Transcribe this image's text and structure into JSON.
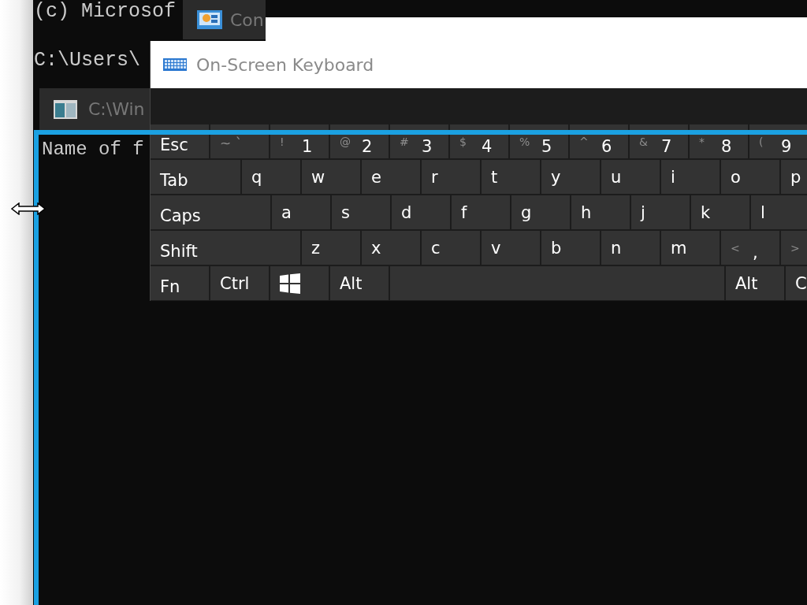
{
  "console_back": {
    "lines": [
      "(c) Microsof",
      "C:\\Users\\"
    ]
  },
  "console_tab": {
    "title": "Con"
  },
  "console_window": {
    "title": "C:\\Win",
    "lines": [
      "Name of f"
    ]
  },
  "keyboard_window": {
    "title": "On-Screen Keyboard",
    "rows": [
      [
        {
          "kind": "key",
          "label": "Esc"
        },
        {
          "kind": "dual",
          "shift": "~",
          "label": "`"
        },
        {
          "kind": "key",
          "shift": "!",
          "label": "1"
        },
        {
          "kind": "key",
          "shift": "@",
          "label": "2"
        },
        {
          "kind": "key",
          "shift": "#",
          "label": "3"
        },
        {
          "kind": "key",
          "shift": "$",
          "label": "4"
        },
        {
          "kind": "key",
          "shift": "%",
          "label": "5"
        },
        {
          "kind": "key",
          "shift": "^",
          "label": "6"
        },
        {
          "kind": "key",
          "shift": "&",
          "label": "7"
        },
        {
          "kind": "key",
          "shift": "*",
          "label": "8"
        },
        {
          "kind": "key",
          "shift": "(",
          "label": "9"
        }
      ],
      [
        {
          "kind": "tab",
          "label": "Tab"
        },
        {
          "kind": "key",
          "label": "q"
        },
        {
          "kind": "key",
          "label": "w"
        },
        {
          "kind": "key",
          "label": "e"
        },
        {
          "kind": "key",
          "label": "r"
        },
        {
          "kind": "key",
          "label": "t"
        },
        {
          "kind": "key",
          "label": "y"
        },
        {
          "kind": "key",
          "label": "u"
        },
        {
          "kind": "key",
          "label": "i"
        },
        {
          "kind": "key",
          "label": "o"
        },
        {
          "kind": "key",
          "label": "p"
        }
      ],
      [
        {
          "kind": "caps",
          "label": "Caps"
        },
        {
          "kind": "key",
          "label": "a"
        },
        {
          "kind": "key",
          "label": "s"
        },
        {
          "kind": "key",
          "label": "d"
        },
        {
          "kind": "key",
          "label": "f"
        },
        {
          "kind": "key",
          "label": "g"
        },
        {
          "kind": "key",
          "label": "h"
        },
        {
          "kind": "key",
          "label": "j"
        },
        {
          "kind": "key",
          "label": "k"
        },
        {
          "kind": "key",
          "label": "l"
        }
      ],
      [
        {
          "kind": "shift",
          "label": "Shift"
        },
        {
          "kind": "key",
          "label": "z"
        },
        {
          "kind": "key",
          "label": "x"
        },
        {
          "kind": "key",
          "label": "c"
        },
        {
          "kind": "key",
          "label": "v"
        },
        {
          "kind": "key",
          "label": "b"
        },
        {
          "kind": "key",
          "label": "n"
        },
        {
          "kind": "key",
          "label": "m"
        },
        {
          "kind": "key",
          "shift": "<",
          "label": ","
        },
        {
          "kind": "key",
          "shift": ">"
        }
      ],
      [
        {
          "kind": "key",
          "label": "Fn"
        },
        {
          "kind": "key",
          "label": "Ctrl"
        },
        {
          "kind": "windows"
        },
        {
          "kind": "key",
          "label": "Alt"
        },
        {
          "kind": "space"
        },
        {
          "kind": "key",
          "label": "Alt"
        },
        {
          "kind": "key",
          "label": "C"
        }
      ]
    ]
  }
}
